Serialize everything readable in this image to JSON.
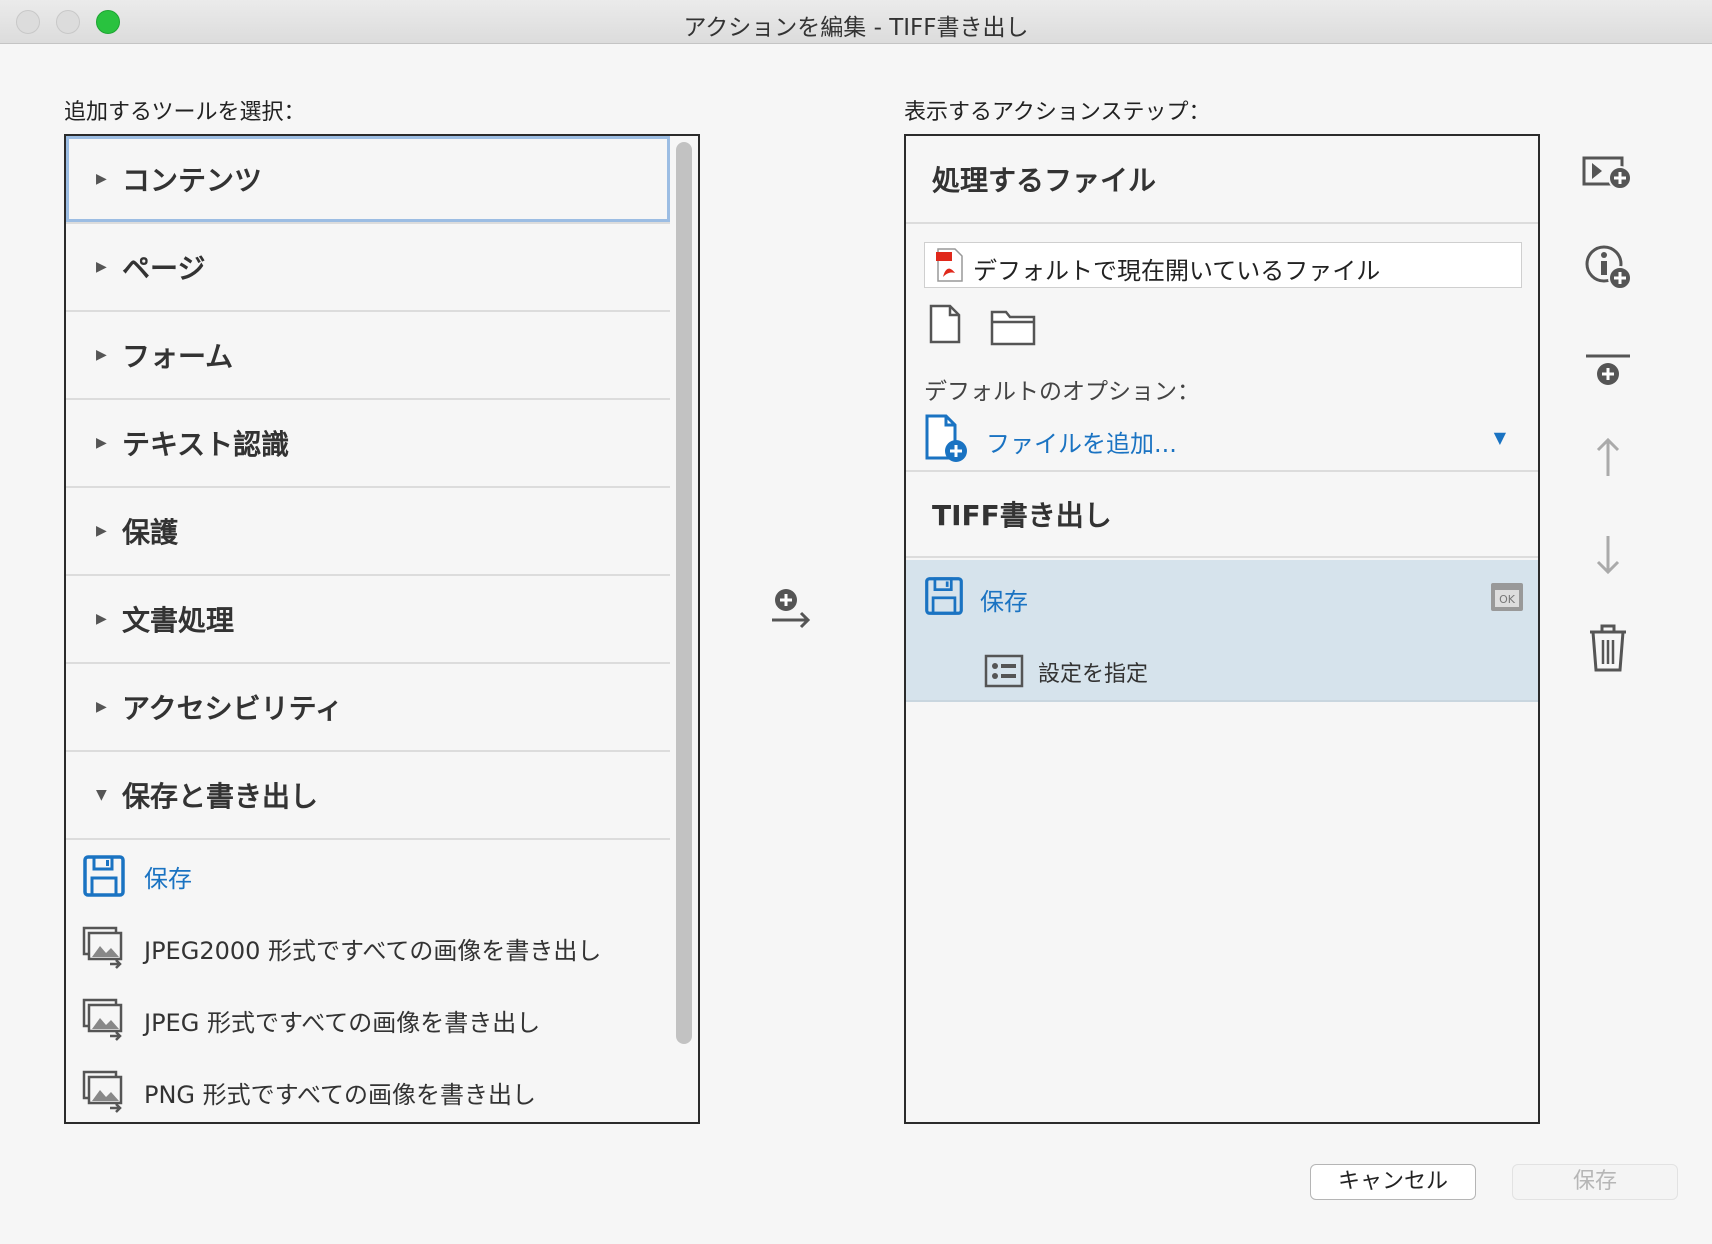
{
  "window": {
    "title": "アクションを編集 - TIFF書き出し"
  },
  "left": {
    "label": "追加するツールを選択：",
    "categories": [
      {
        "label": "コンテンツ",
        "expanded": false,
        "icon": "triangle-right-icon"
      },
      {
        "label": "ページ",
        "expanded": false,
        "icon": "triangle-right-icon"
      },
      {
        "label": "フォーム",
        "expanded": false,
        "icon": "triangle-right-icon"
      },
      {
        "label": "テキスト認識",
        "expanded": false,
        "icon": "triangle-right-icon"
      },
      {
        "label": "保護",
        "expanded": false,
        "icon": "triangle-right-icon"
      },
      {
        "label": "文書処理",
        "expanded": false,
        "icon": "triangle-right-icon"
      },
      {
        "label": "アクセシビリティ",
        "expanded": false,
        "icon": "triangle-right-icon"
      },
      {
        "label": "保存と書き出し",
        "expanded": true,
        "icon": "triangle-down-icon"
      }
    ],
    "tools": [
      {
        "label": "保存",
        "icon": "save-disk-icon"
      },
      {
        "label": "JPEG2000 形式ですべての画像を書き出し",
        "icon": "export-images-icon"
      },
      {
        "label": "JPEG 形式ですべての画像を書き出し",
        "icon": "export-images-icon"
      },
      {
        "label": "PNG 形式ですべての画像を書き出し",
        "icon": "export-images-icon"
      }
    ]
  },
  "right": {
    "label": "表示するアクションステップ：",
    "files_heading": "処理するファイル",
    "default_file": "デフォルトで現在開いているファイル",
    "options_label": "デフォルトのオプション：",
    "add_file": "ファイルを追加...",
    "step_heading": "TIFF書き出し",
    "step_save": "保存",
    "step_settings": "設定を指定"
  },
  "side_tools": [
    "add-instruction-icon",
    "add-info-icon",
    "add-divider-icon",
    "move-up-icon",
    "move-down-icon",
    "delete-trash-icon"
  ],
  "footer": {
    "cancel": "キャンセル",
    "save": "保存"
  },
  "colors": {
    "accent_blue": "#1a73c2",
    "selection_bg": "#d6e3ec",
    "pdf_red": "#e0281b"
  }
}
